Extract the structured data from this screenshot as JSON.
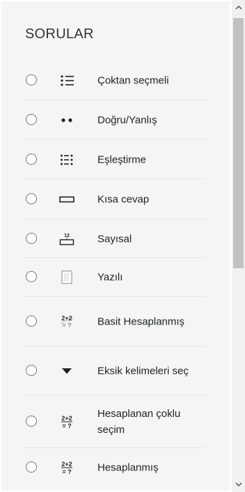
{
  "panel": {
    "title": "SORULAR"
  },
  "question_types": [
    {
      "label": "Çoktan seçmeli",
      "icon": "multichoice-icon"
    },
    {
      "label": "Doğru/Yanlış",
      "icon": "truefalse-icon"
    },
    {
      "label": "Eşleştirme",
      "icon": "match-icon"
    },
    {
      "label": "Kısa cevap",
      "icon": "shortanswer-icon"
    },
    {
      "label": "Sayısal",
      "icon": "numerical-icon"
    },
    {
      "label": "Yazılı",
      "icon": "essay-icon"
    },
    {
      "label": "Basit Hesaplanmış",
      "icon": "calculated-simple-icon",
      "icon_text": [
        "2+2",
        "= ?"
      ]
    },
    {
      "label": "Eksik kelimeleri seç",
      "icon": "dropdown-arrow-icon"
    },
    {
      "label": "Hesaplanan çoklu seçim",
      "icon": "calculated-multi-icon",
      "icon_text": [
        "2+2",
        "= ?"
      ]
    },
    {
      "label": "Hesaplanmış",
      "icon": "calculated-icon",
      "icon_text": [
        "2+2",
        "= ?"
      ]
    }
  ],
  "numerical_icon_text": "12",
  "colors": {
    "panel_bg": "#f5f5f5",
    "text": "#1d2125",
    "separator": "#e6e6e6",
    "scroll_thumb": "#c1c1c1"
  }
}
